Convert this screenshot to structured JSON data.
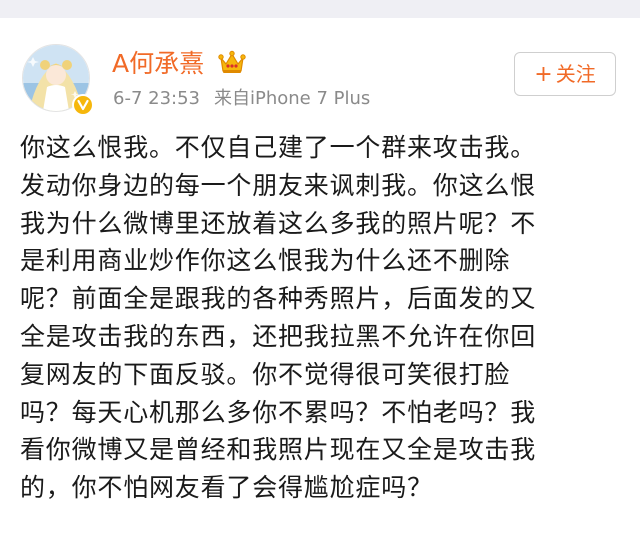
{
  "colors": {
    "username": "#f16a27",
    "meta": "#8a8a8a",
    "text": "#1a1a1a",
    "follow_accent": "#f16a27",
    "page_band": "#efeff4"
  },
  "author": {
    "name": "A何承熹",
    "avatar_icon": "anime-girl-avatar",
    "badge_icon": "verified-v-icon",
    "member_icon": "crown-icon"
  },
  "meta": {
    "time": "6-7 23:53",
    "source": "来自iPhone 7 Plus"
  },
  "follow": {
    "plus": "+",
    "label": "关注"
  },
  "post": {
    "lines": [
      "你这么恨我。不仅自己建了一个群来攻击我。",
      "发动你身边的每一个朋友来讽刺我。你这么恨",
      "我为什么微博里还放着这么多我的照片呢？不",
      "是利用商业炒作你这么恨我为什么还不删除",
      "呢？前面全是跟我的各种秀照片，后面发的又",
      "全是攻击我的东西，还把我拉黑不允许在你回",
      "复网友的下面反驳。你不觉得很可笑很打脸",
      "吗？每天心机那么多你不累吗？不怕老吗？我",
      "看你微博又是曾经和我照片现在又全是攻击我",
      "的，你不怕网友看了会得尴尬症吗？"
    ]
  }
}
